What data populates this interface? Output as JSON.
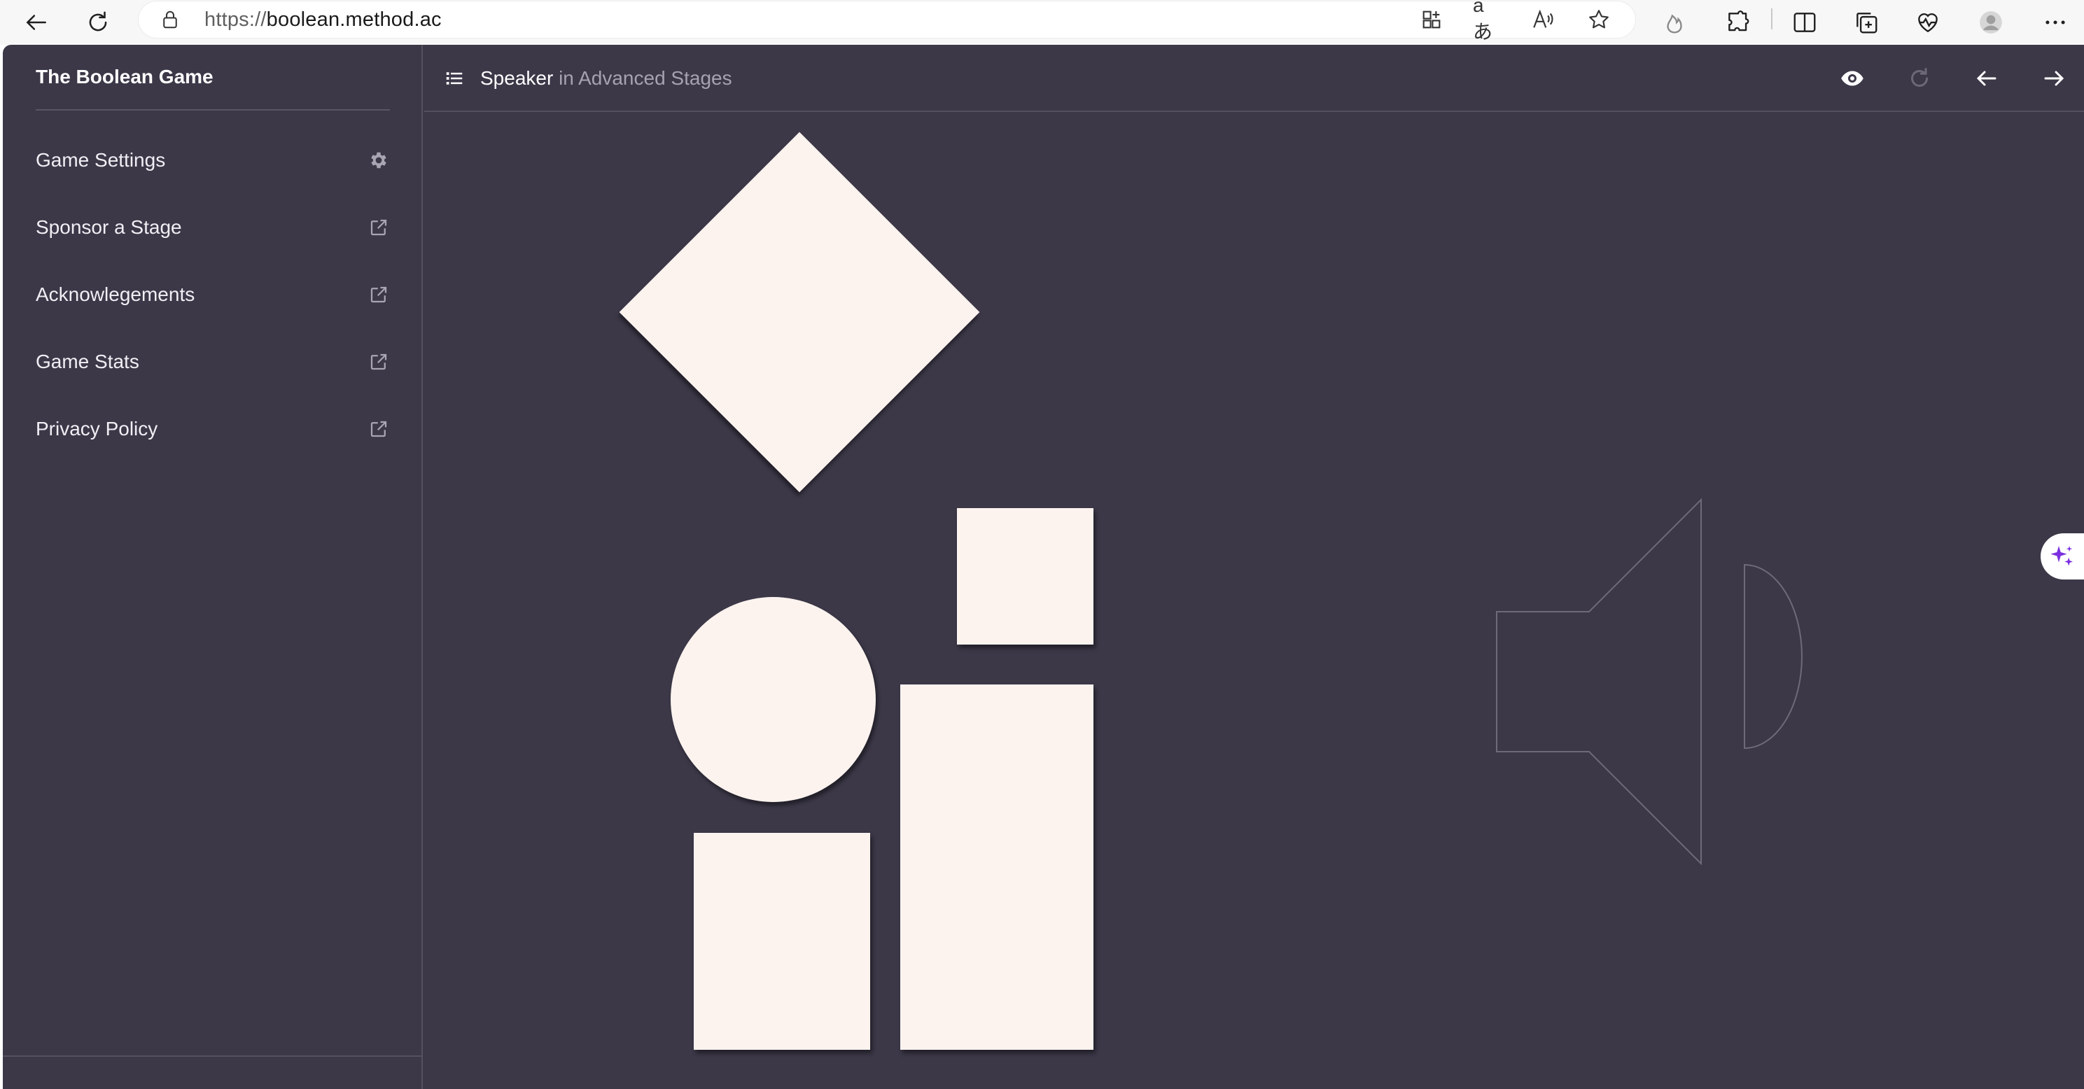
{
  "browser": {
    "url_scheme": "https://",
    "url_host": "boolean.method.ac",
    "translate_glyph": "aあ",
    "read_aloud_glyph": "A))"
  },
  "sidebar": {
    "title": "The Boolean Game",
    "items": [
      {
        "label": "Game Settings",
        "icon": "gear-icon"
      },
      {
        "label": "Sponsor a Stage",
        "icon": "external-link-icon"
      },
      {
        "label": "Acknowlegements",
        "icon": "external-link-icon"
      },
      {
        "label": "Game Stats",
        "icon": "external-link-icon"
      },
      {
        "label": "Privacy Policy",
        "icon": "external-link-icon"
      }
    ]
  },
  "header": {
    "level_name": "Speaker",
    "level_context": " in Advanced Stages"
  },
  "colors": {
    "app_background": "#3c3848",
    "shape_fill": "#fcf3ef",
    "target_outline": "#6e6a7a"
  }
}
